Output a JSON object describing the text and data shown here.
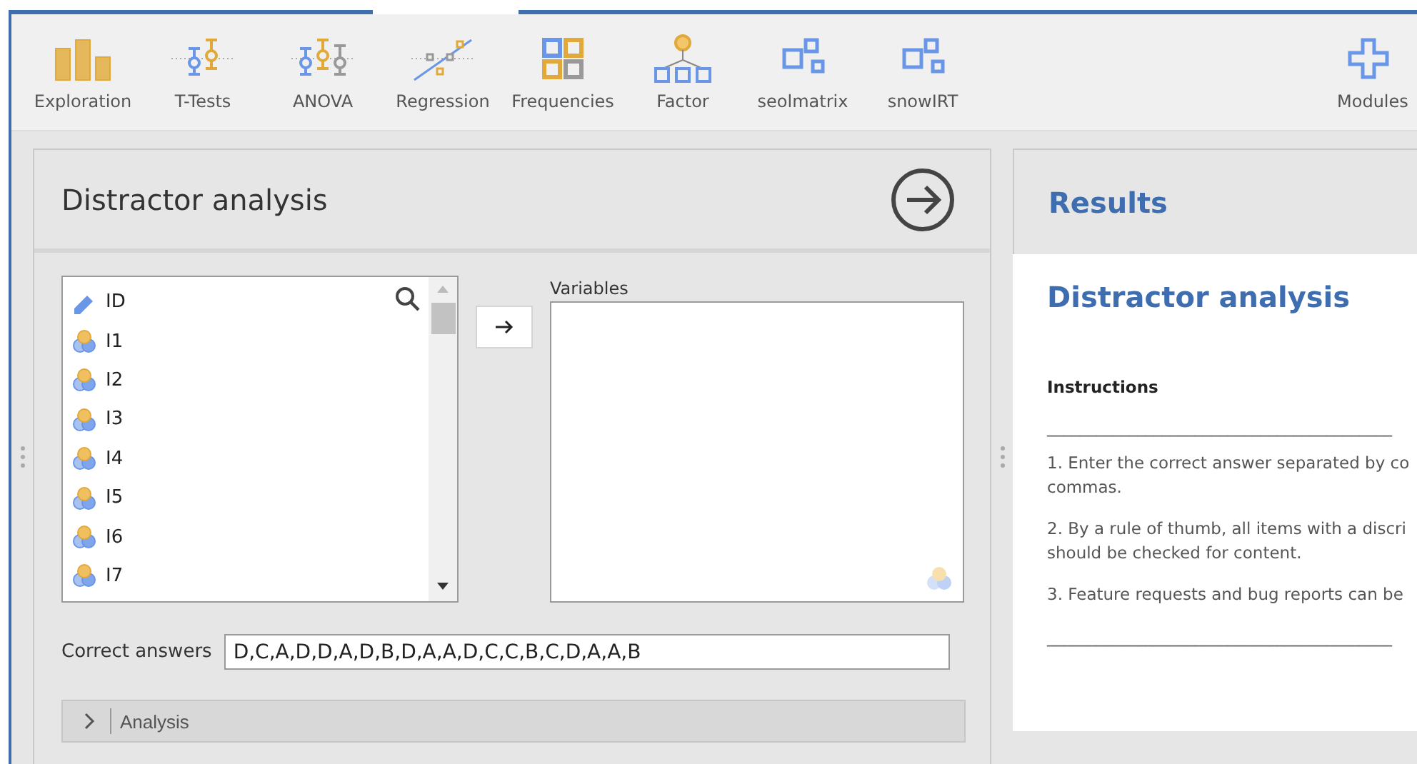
{
  "toolbar": {
    "items": [
      {
        "label": "Exploration",
        "kind": "bars"
      },
      {
        "label": "T-Tests",
        "kind": "ttest"
      },
      {
        "label": "ANOVA",
        "kind": "anova"
      },
      {
        "label": "Regression",
        "kind": "regression"
      },
      {
        "label": "Frequencies",
        "kind": "grid"
      },
      {
        "label": "Factor",
        "kind": "tree"
      },
      {
        "label": "seolmatrix",
        "kind": "module"
      },
      {
        "label": "snowIRT",
        "kind": "module"
      }
    ],
    "modules": {
      "label": "Modules"
    }
  },
  "options_panel": {
    "title": "Distractor analysis",
    "variable_list": [
      {
        "name": "ID",
        "kind": "id"
      },
      {
        "name": "I1",
        "kind": "ordinal"
      },
      {
        "name": "I2",
        "kind": "ordinal"
      },
      {
        "name": "I3",
        "kind": "ordinal"
      },
      {
        "name": "I4",
        "kind": "ordinal"
      },
      {
        "name": "I5",
        "kind": "ordinal"
      },
      {
        "name": "I6",
        "kind": "ordinal"
      },
      {
        "name": "I7",
        "kind": "ordinal"
      }
    ],
    "target": {
      "label": "Variables"
    },
    "correct_answers": {
      "label": "Correct answers",
      "value": "D,C,A,D,D,A,D,B,D,A,A,D,C,C,B,C,D,A,A,B"
    },
    "sections": [
      {
        "label": "Analysis",
        "expanded": false
      }
    ]
  },
  "results": {
    "header": "Results",
    "title": "Distractor analysis",
    "subtitle": "Instructions",
    "blocks": [
      {
        "kind": "rule",
        "text": "__________________________________________"
      },
      {
        "kind": "para",
        "lines": [
          "1. Enter the correct answer separated by co",
          "commas."
        ]
      },
      {
        "kind": "para",
        "lines": [
          "2. By a rule of thumb, all items with a discri",
          "should be checked for content."
        ]
      },
      {
        "kind": "para",
        "lines": [
          "3. Feature requests and bug reports can be"
        ]
      },
      {
        "kind": "rule",
        "text": "__________________________________________"
      }
    ]
  }
}
